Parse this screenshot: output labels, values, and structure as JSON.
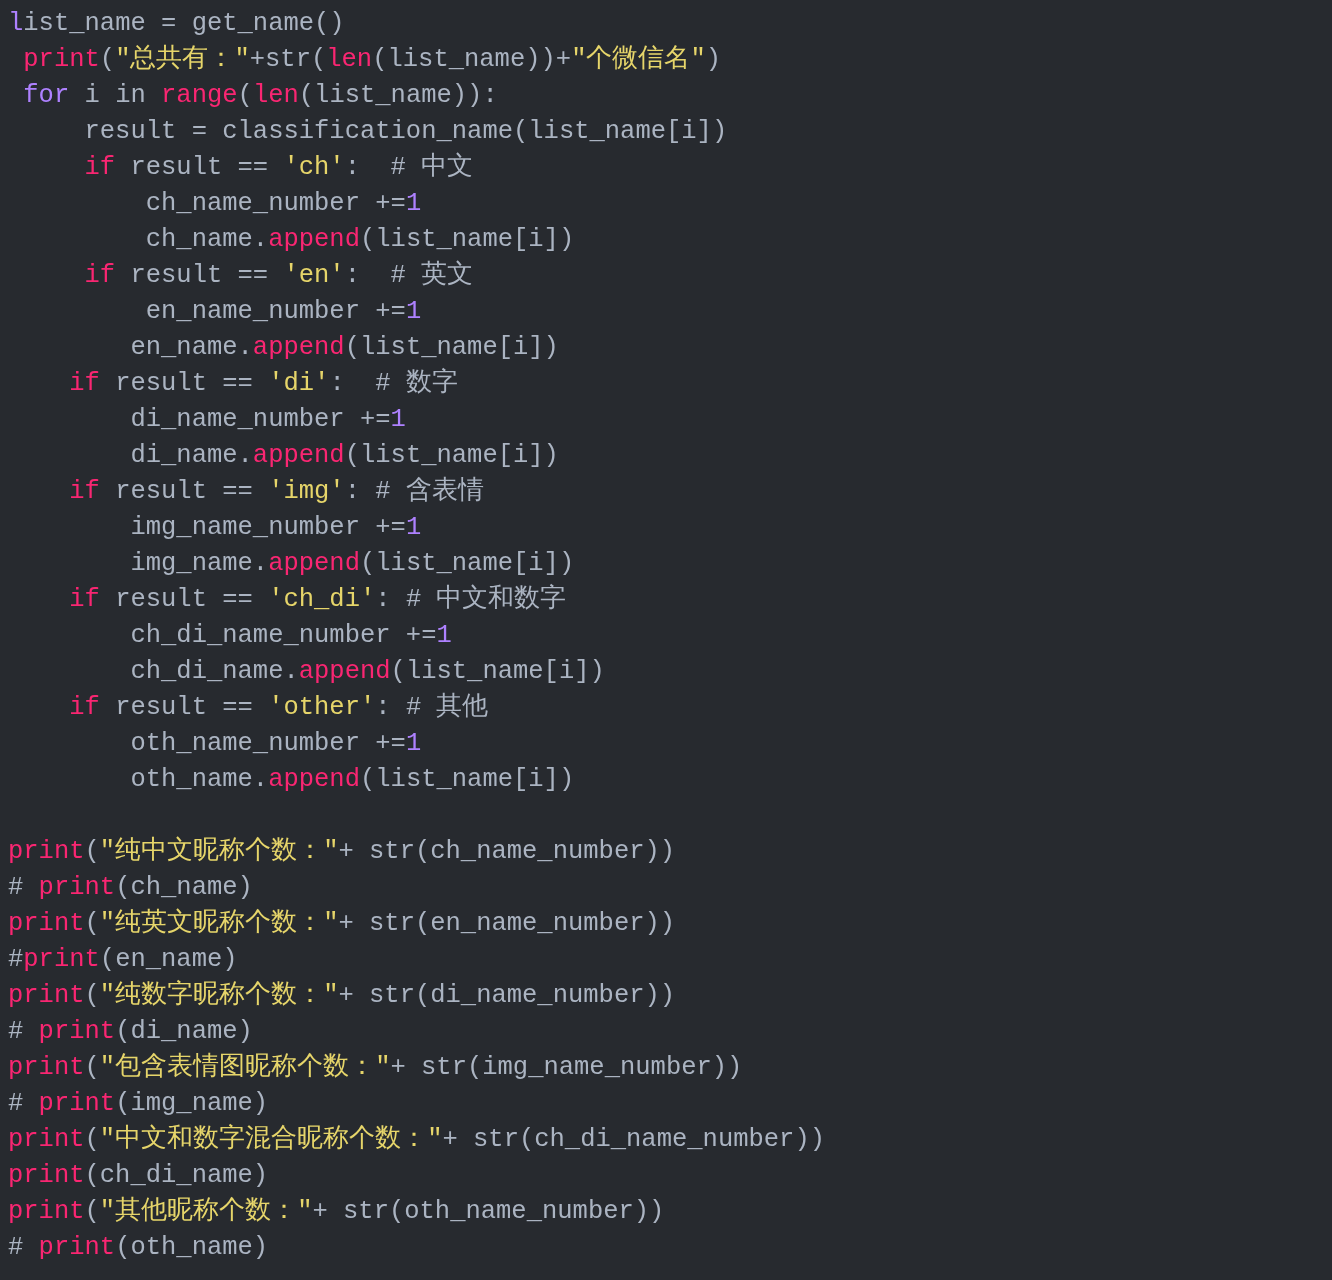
{
  "editor": {
    "lines": [
      {
        "kind": "code",
        "tokens": [
          {
            "kind": "constant",
            "text": "l"
          },
          {
            "kind": "plain",
            "text": "ist_name = get_name()"
          }
        ]
      },
      {
        "kind": "code",
        "tokens": [
          {
            "kind": "keyword",
            "text": " print"
          },
          {
            "kind": "plain",
            "text": "("
          },
          {
            "kind": "string",
            "text": "\"总共有：\""
          },
          {
            "kind": "plain",
            "text": "+str("
          },
          {
            "kind": "keyword",
            "text": "len"
          },
          {
            "kind": "plain",
            "text": "(list_name))+"
          },
          {
            "kind": "string",
            "text": "\"个微信名\""
          },
          {
            "kind": "plain",
            "text": ")"
          }
        ]
      },
      {
        "kind": "code",
        "tokens": [
          {
            "kind": "constant",
            "text": " for"
          },
          {
            "kind": "plain",
            "text": " i in "
          },
          {
            "kind": "keyword",
            "text": "range"
          },
          {
            "kind": "plain",
            "text": "("
          },
          {
            "kind": "keyword",
            "text": "len"
          },
          {
            "kind": "plain",
            "text": "(list_name)):"
          }
        ]
      },
      {
        "kind": "code",
        "tokens": [
          {
            "kind": "plain",
            "text": "     result = classification_name(list_name[i])"
          }
        ]
      },
      {
        "kind": "code",
        "tokens": [
          {
            "kind": "keyword",
            "text": "     if"
          },
          {
            "kind": "plain",
            "text": " result == "
          },
          {
            "kind": "string",
            "text": "'ch'"
          },
          {
            "kind": "plain",
            "text": ":  # 中文"
          }
        ]
      },
      {
        "kind": "code",
        "tokens": [
          {
            "kind": "plain",
            "text": "         ch_name_number +="
          },
          {
            "kind": "constant",
            "text": "1"
          }
        ]
      },
      {
        "kind": "code",
        "tokens": [
          {
            "kind": "plain",
            "text": "         ch_name."
          },
          {
            "kind": "keyword",
            "text": "append"
          },
          {
            "kind": "plain",
            "text": "(list_name[i])"
          }
        ]
      },
      {
        "kind": "code",
        "tokens": [
          {
            "kind": "keyword",
            "text": "     if"
          },
          {
            "kind": "plain",
            "text": " result == "
          },
          {
            "kind": "string",
            "text": "'en'"
          },
          {
            "kind": "plain",
            "text": ":  # 英文"
          }
        ]
      },
      {
        "kind": "code",
        "tokens": [
          {
            "kind": "plain",
            "text": "         en_name_number +="
          },
          {
            "kind": "constant",
            "text": "1"
          }
        ]
      },
      {
        "kind": "code",
        "tokens": [
          {
            "kind": "plain",
            "text": "        en_name."
          },
          {
            "kind": "keyword",
            "text": "append"
          },
          {
            "kind": "plain",
            "text": "(list_name[i])"
          }
        ]
      },
      {
        "kind": "code",
        "tokens": [
          {
            "kind": "keyword",
            "text": "    if"
          },
          {
            "kind": "plain",
            "text": " result == "
          },
          {
            "kind": "string",
            "text": "'di'"
          },
          {
            "kind": "plain",
            "text": ":  # 数字"
          }
        ]
      },
      {
        "kind": "code",
        "tokens": [
          {
            "kind": "plain",
            "text": "        di_name_number +="
          },
          {
            "kind": "constant",
            "text": "1"
          }
        ]
      },
      {
        "kind": "code",
        "tokens": [
          {
            "kind": "plain",
            "text": "        di_name."
          },
          {
            "kind": "keyword",
            "text": "append"
          },
          {
            "kind": "plain",
            "text": "(list_name[i])"
          }
        ]
      },
      {
        "kind": "code",
        "tokens": [
          {
            "kind": "keyword",
            "text": "    if"
          },
          {
            "kind": "plain",
            "text": " result == "
          },
          {
            "kind": "string",
            "text": "'img'"
          },
          {
            "kind": "plain",
            "text": ": # 含表情"
          }
        ]
      },
      {
        "kind": "code",
        "tokens": [
          {
            "kind": "plain",
            "text": "        img_name_number +="
          },
          {
            "kind": "constant",
            "text": "1"
          }
        ]
      },
      {
        "kind": "code",
        "tokens": [
          {
            "kind": "plain",
            "text": "        img_name."
          },
          {
            "kind": "keyword",
            "text": "append"
          },
          {
            "kind": "plain",
            "text": "(list_name[i])"
          }
        ]
      },
      {
        "kind": "code",
        "tokens": [
          {
            "kind": "keyword",
            "text": "    if"
          },
          {
            "kind": "plain",
            "text": " result == "
          },
          {
            "kind": "string",
            "text": "'ch_di'"
          },
          {
            "kind": "plain",
            "text": ": # 中文和数字"
          }
        ]
      },
      {
        "kind": "code",
        "tokens": [
          {
            "kind": "plain",
            "text": "        ch_di_name_number +="
          },
          {
            "kind": "constant",
            "text": "1"
          }
        ]
      },
      {
        "kind": "code",
        "tokens": [
          {
            "kind": "plain",
            "text": "        ch_di_name."
          },
          {
            "kind": "keyword",
            "text": "append"
          },
          {
            "kind": "plain",
            "text": "(list_name[i])"
          }
        ]
      },
      {
        "kind": "code",
        "tokens": [
          {
            "kind": "keyword",
            "text": "    if"
          },
          {
            "kind": "plain",
            "text": " result == "
          },
          {
            "kind": "string",
            "text": "'other'"
          },
          {
            "kind": "plain",
            "text": ": # 其他"
          }
        ]
      },
      {
        "kind": "code",
        "tokens": [
          {
            "kind": "plain",
            "text": "        oth_name_number +="
          },
          {
            "kind": "constant",
            "text": "1"
          }
        ]
      },
      {
        "kind": "code",
        "tokens": [
          {
            "kind": "plain",
            "text": "        oth_name."
          },
          {
            "kind": "keyword",
            "text": "append"
          },
          {
            "kind": "plain",
            "text": "(list_name[i])"
          }
        ]
      },
      {
        "kind": "blank"
      },
      {
        "kind": "code",
        "tokens": [
          {
            "kind": "keyword",
            "text": "print"
          },
          {
            "kind": "plain",
            "text": "("
          },
          {
            "kind": "string",
            "text": "\"纯中文昵称个数：\""
          },
          {
            "kind": "plain",
            "text": "+ str(ch_name_number))"
          }
        ]
      },
      {
        "kind": "code",
        "tokens": [
          {
            "kind": "plain",
            "text": "# "
          },
          {
            "kind": "keyword",
            "text": "print"
          },
          {
            "kind": "plain",
            "text": "(ch_name)"
          }
        ]
      },
      {
        "kind": "code",
        "tokens": [
          {
            "kind": "keyword",
            "text": "print"
          },
          {
            "kind": "plain",
            "text": "("
          },
          {
            "kind": "string",
            "text": "\"纯英文昵称个数：\""
          },
          {
            "kind": "plain",
            "text": "+ str(en_name_number))"
          }
        ]
      },
      {
        "kind": "code",
        "tokens": [
          {
            "kind": "plain",
            "text": "#"
          },
          {
            "kind": "keyword",
            "text": "print"
          },
          {
            "kind": "plain",
            "text": "(en_name)"
          }
        ]
      },
      {
        "kind": "code",
        "tokens": [
          {
            "kind": "keyword",
            "text": "print"
          },
          {
            "kind": "plain",
            "text": "("
          },
          {
            "kind": "string",
            "text": "\"纯数字昵称个数：\""
          },
          {
            "kind": "plain",
            "text": "+ str(di_name_number))"
          }
        ]
      },
      {
        "kind": "code",
        "tokens": [
          {
            "kind": "plain",
            "text": "# "
          },
          {
            "kind": "keyword",
            "text": "print"
          },
          {
            "kind": "plain",
            "text": "(di_name)"
          }
        ]
      },
      {
        "kind": "code",
        "tokens": [
          {
            "kind": "keyword",
            "text": "print"
          },
          {
            "kind": "plain",
            "text": "("
          },
          {
            "kind": "string",
            "text": "\"包含表情图昵称个数：\""
          },
          {
            "kind": "plain",
            "text": "+ str(img_name_number))"
          }
        ]
      },
      {
        "kind": "code",
        "tokens": [
          {
            "kind": "plain",
            "text": "# "
          },
          {
            "kind": "keyword",
            "text": "print"
          },
          {
            "kind": "plain",
            "text": "(img_name)"
          }
        ]
      },
      {
        "kind": "code",
        "tokens": [
          {
            "kind": "keyword",
            "text": "print"
          },
          {
            "kind": "plain",
            "text": "("
          },
          {
            "kind": "string",
            "text": "\"中文和数字混合昵称个数：\""
          },
          {
            "kind": "plain",
            "text": "+ str(ch_di_name_number))"
          }
        ]
      },
      {
        "kind": "code",
        "tokens": [
          {
            "kind": "keyword",
            "text": "print"
          },
          {
            "kind": "plain",
            "text": "(ch_di_name)"
          }
        ]
      },
      {
        "kind": "code",
        "tokens": [
          {
            "kind": "keyword",
            "text": "print"
          },
          {
            "kind": "plain",
            "text": "("
          },
          {
            "kind": "string",
            "text": "\"其他昵称个数：\""
          },
          {
            "kind": "plain",
            "text": "+ str(oth_name_number))"
          }
        ]
      },
      {
        "kind": "code",
        "tokens": [
          {
            "kind": "plain",
            "text": "# "
          },
          {
            "kind": "keyword",
            "text": "print"
          },
          {
            "kind": "plain",
            "text": "(oth_name)"
          }
        ]
      }
    ]
  }
}
